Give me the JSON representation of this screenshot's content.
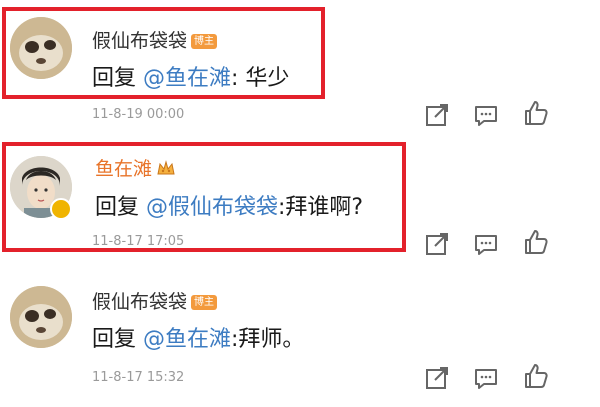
{
  "comments": [
    {
      "author": "假仙布袋袋",
      "badge": "博主",
      "reply_prefix": "回复 ",
      "mention": "@鱼在滩",
      "text": ": 华少",
      "time": "11-8-19 00:00"
    },
    {
      "author": "鱼在滩",
      "reply_prefix": "回复 ",
      "mention": "@假仙布袋袋",
      "text": ":拜谁啊?",
      "time": "11-8-17 17:05"
    },
    {
      "author": "假仙布袋袋",
      "badge": "博主",
      "reply_prefix": "回复 ",
      "mention": "@鱼在滩",
      "text": ":拜师。",
      "time": "11-8-17 15:32"
    }
  ],
  "icons": [
    "share-icon",
    "comment-icon",
    "like-icon"
  ],
  "colors": {
    "highlight": "#e3212b",
    "mention": "#3d7cc2",
    "badge": "#f39a3d",
    "orange_name": "#e8742a"
  }
}
